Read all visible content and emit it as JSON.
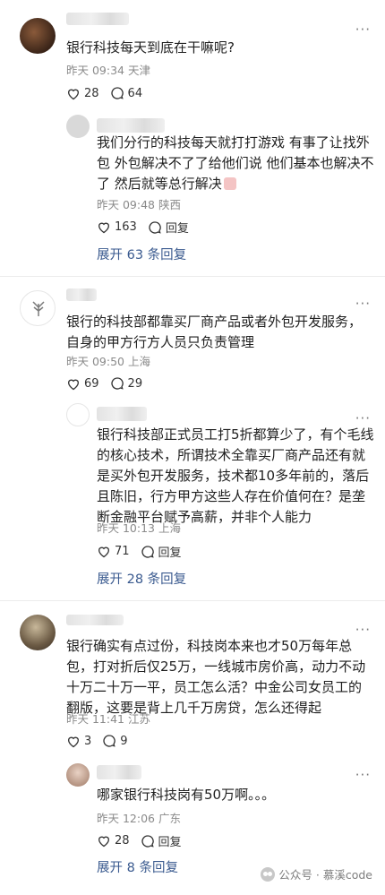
{
  "threads": [
    {
      "comment": {
        "text": "银行科技每天到底在干嘛呢?",
        "time": "昨天 09:34",
        "location": "天津",
        "likes": "28",
        "comments": "64"
      },
      "reply": {
        "text": "我们分行的科技每天就打打游戏 有事了让找外包 外包解决不了了给他们说 他们基本也解决不了 然后就等总行解决",
        "time": "昨天 09:48",
        "location": "陕西",
        "likes": "163",
        "reply_label": "回复"
      },
      "expand": "展开 63 条回复"
    },
    {
      "comment": {
        "text": "银行的科技部都靠买厂商产品或者外包开发服务，自身的甲方行方人员只负责管理",
        "time": "昨天 09:50",
        "location": "上海",
        "likes": "69",
        "comments": "29"
      },
      "reply": {
        "text": "银行科技部正式员工打5折都算少了，有个毛线的核心技术，所谓技术全靠买厂商产品还有就是买外包开发服务，技术都10多年前的，落后且陈旧，行方甲方这些人存在价值何在？是垄断金融平台赋予高薪，并非个人能力",
        "time": "昨天 10:13",
        "location": "上海",
        "likes": "71",
        "reply_label": "回复"
      },
      "expand": "展开 28 条回复"
    },
    {
      "comment": {
        "text": "银行确实有点过份，科技岗本来也才50万每年总包，打对折后仅25万，一线城市房价高，动力不动十万二十万一平，员工怎么活？中金公司女员工的翻版，这要是背上几千万房贷，怎么还得起",
        "time": "昨天 11:41",
        "location": "江苏",
        "likes": "3",
        "comments": "9"
      },
      "reply": {
        "text": "哪家银行科技岗有50万啊。。。",
        "time": "昨天 12:06",
        "location": "广东",
        "likes": "28",
        "reply_label": "回复"
      },
      "expand": "展开 8 条回复"
    }
  ],
  "more_label": "···",
  "watermark": {
    "text": "公众号 · 慕溪code"
  }
}
